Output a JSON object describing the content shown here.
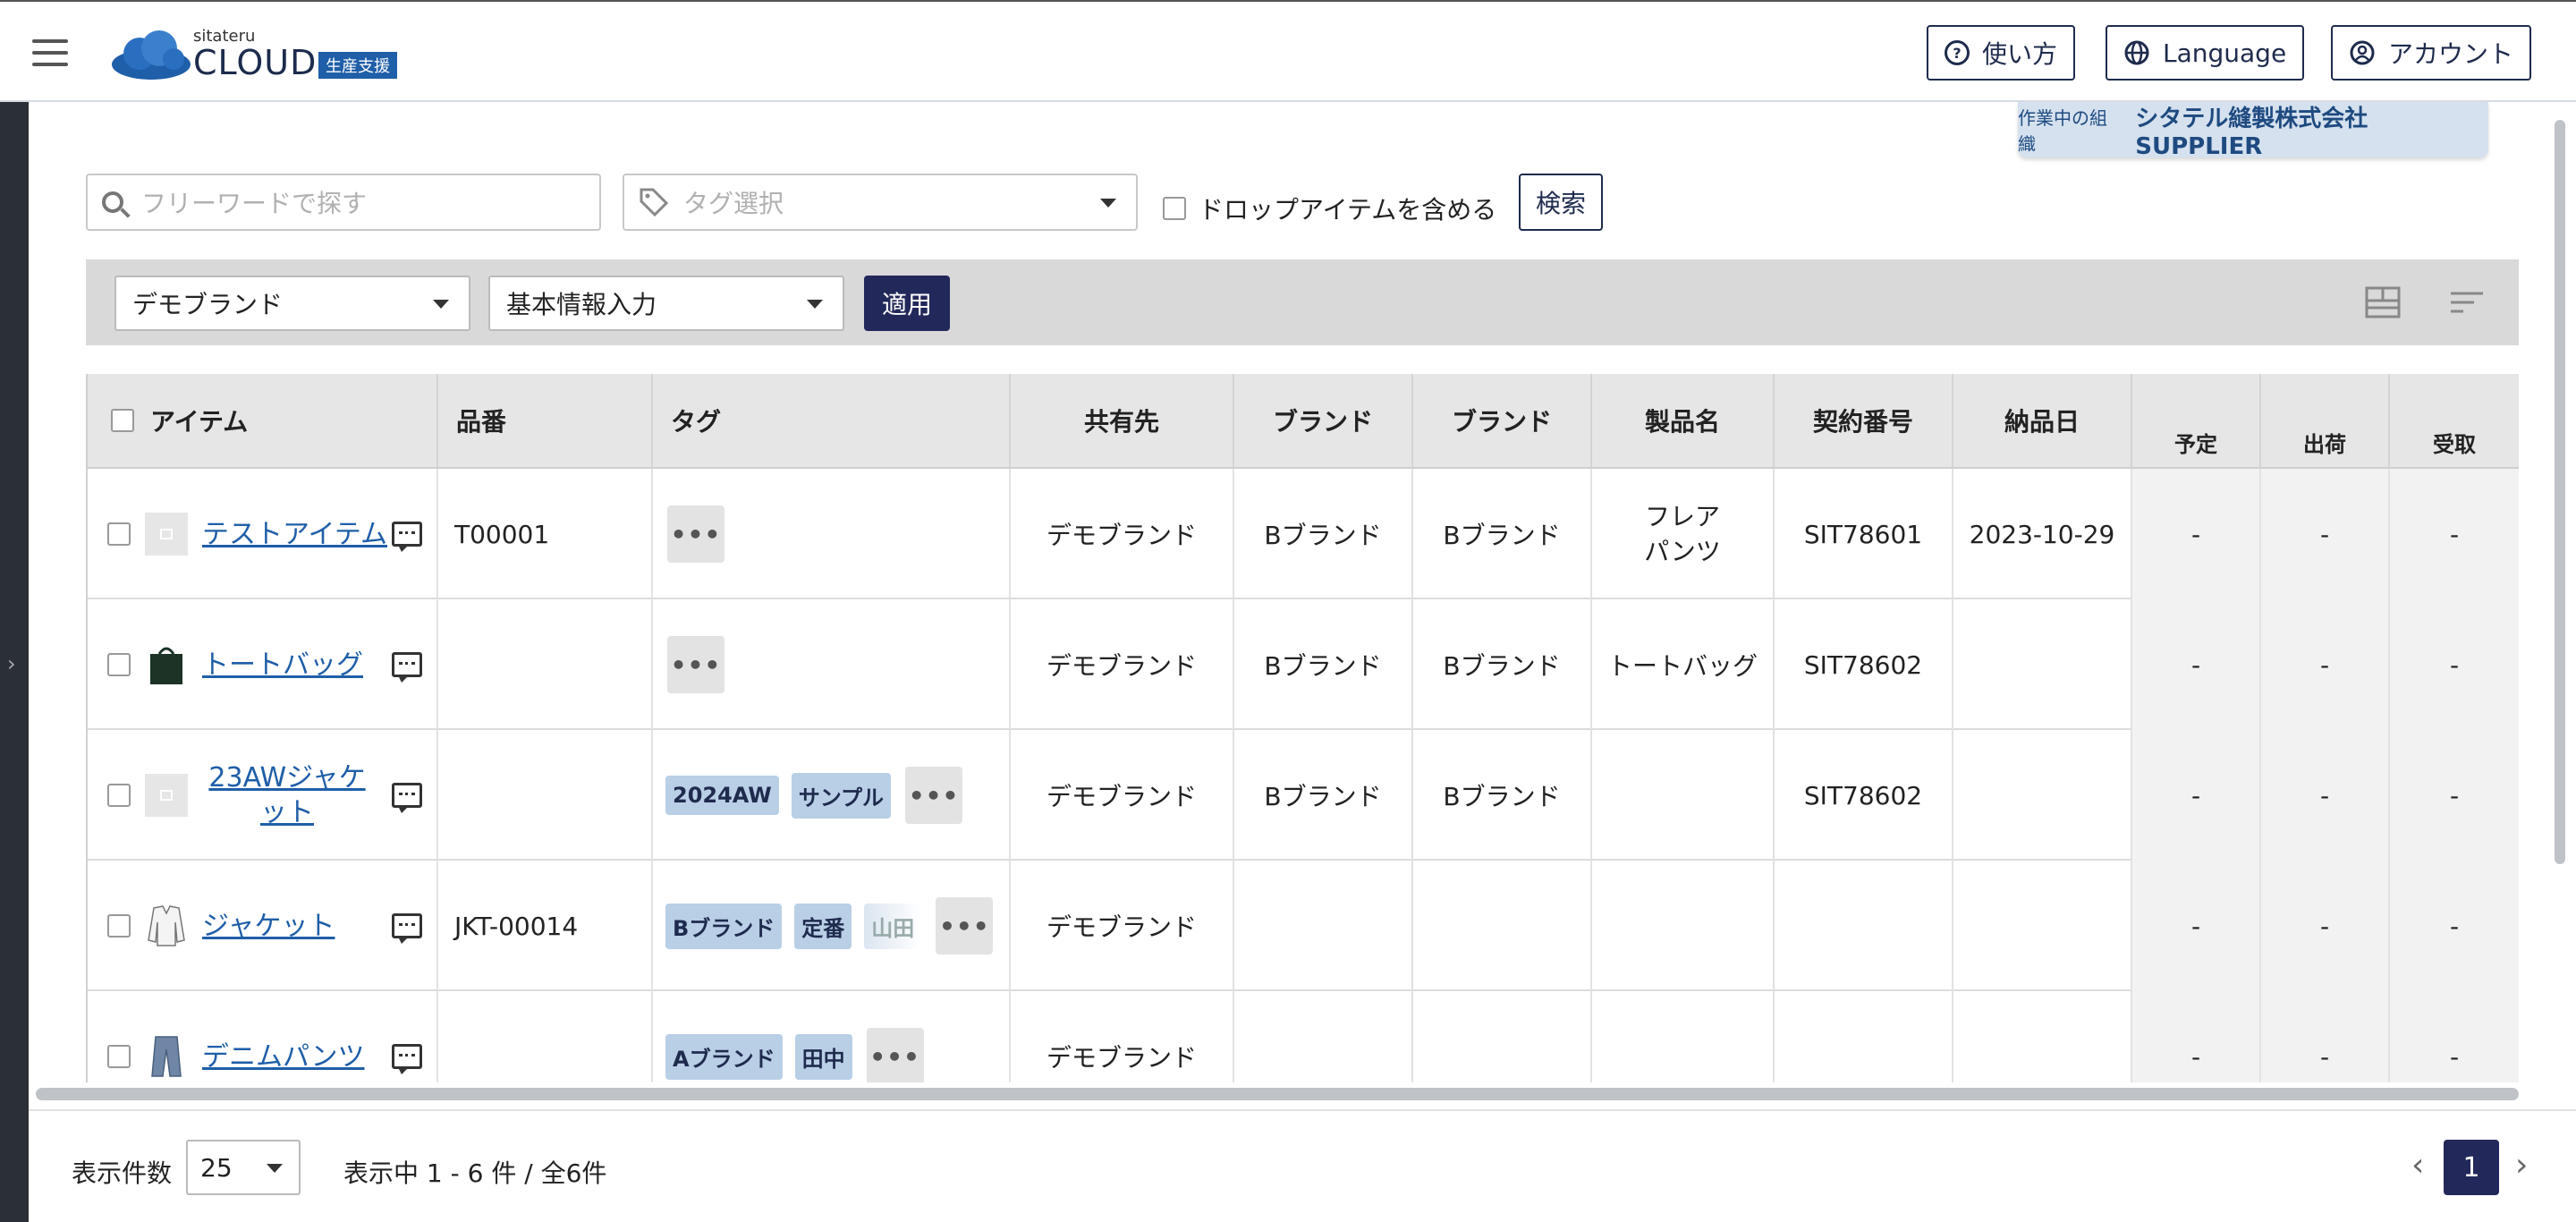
{
  "header": {
    "logo_small": "sitateru",
    "logo_big": "CLOUD",
    "logo_badge": "生産支援",
    "help_label": "使い方",
    "language_label": "Language",
    "account_label": "アカウント"
  },
  "org": {
    "label": "作業中の組織",
    "name": "シタテル縫製株式会社 SUPPLIER"
  },
  "search": {
    "placeholder": "フリーワードで探す",
    "tag_placeholder": "タグ選択",
    "include_drop_label": "ドロップアイテムを含める",
    "search_button": "検索"
  },
  "filter": {
    "brand_select": "デモブランド",
    "step_select": "基本情報入力",
    "apply_button": "適用"
  },
  "table": {
    "columns": {
      "item": "アイテム",
      "part_no": "品番",
      "tags": "タグ",
      "shared": "共有先",
      "brand1": "ブランド",
      "brand2": "ブランド",
      "product_name": "製品名",
      "contract_no": "契約番号",
      "delivery_date": "納品日",
      "planned": "予定",
      "shipping": "出荷",
      "receiving": "受取"
    },
    "rows": [
      {
        "item": "テストアイテム",
        "part_no": "T00001",
        "tags": [],
        "shared": "デモブランド",
        "brand1": "Bブランド",
        "brand2": "Bブランド",
        "product_name": "フレアパンツ",
        "contract_no": "SIT78601",
        "delivery_date": "2023-10-29",
        "planned": "-",
        "shipping": "-",
        "receiving": "-"
      },
      {
        "item": "トートバッグ",
        "part_no": "",
        "tags": [],
        "shared": "デモブランド",
        "brand1": "Bブランド",
        "brand2": "Bブランド",
        "product_name": "トートバッグ",
        "contract_no": "SIT78602",
        "delivery_date": "",
        "planned": "-",
        "shipping": "-",
        "receiving": "-"
      },
      {
        "item": "23AWジャケット",
        "part_no": "",
        "tags": [
          "2024AW",
          "サンプル"
        ],
        "shared": "デモブランド",
        "brand1": "Bブランド",
        "brand2": "Bブランド",
        "product_name": "",
        "contract_no": "SIT78602",
        "delivery_date": "",
        "planned": "-",
        "shipping": "-",
        "receiving": "-"
      },
      {
        "item": "ジャケット",
        "part_no": "JKT-00014",
        "tags": [
          "Bブランド",
          "定番",
          "山田"
        ],
        "shared": "デモブランド",
        "brand1": "",
        "brand2": "",
        "product_name": "",
        "contract_no": "",
        "delivery_date": "",
        "planned": "-",
        "shipping": "-",
        "receiving": "-"
      },
      {
        "item": "デニムパンツ",
        "part_no": "",
        "tags": [
          "Aブランド",
          "田中"
        ],
        "shared": "デモブランド",
        "brand1": "",
        "brand2": "",
        "product_name": "",
        "contract_no": "",
        "delivery_date": "",
        "planned": "-",
        "shipping": "-",
        "receiving": "-"
      }
    ],
    "more_glyph": "•••"
  },
  "footer": {
    "page_size_label": "表示件数",
    "page_size": "25",
    "range_text": "表示中 1 - 6 件 / 全6件",
    "current_page": "1"
  }
}
